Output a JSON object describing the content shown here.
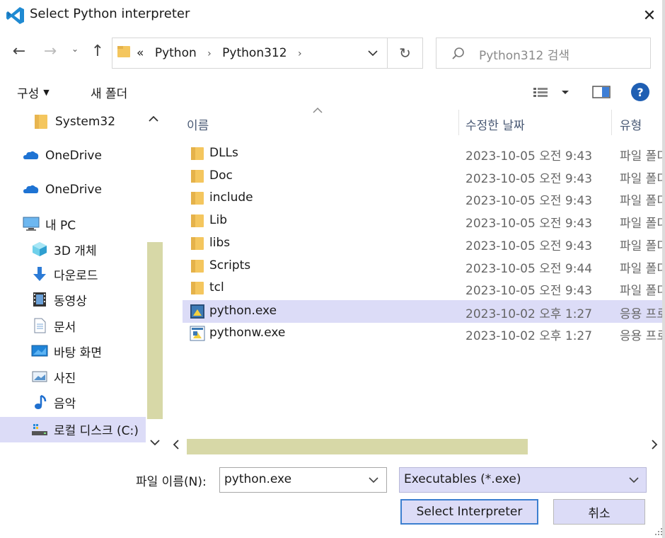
{
  "window": {
    "title": "Select Python interpreter",
    "close_label": "✕"
  },
  "nav": {
    "back": "←",
    "forward": "→",
    "recent": "⌄",
    "up": "↑",
    "breadcrumb_overflow": "«",
    "breadcrumbs": [
      "Python",
      "Python312"
    ],
    "crumb_separator": "›",
    "refresh": "↻"
  },
  "search": {
    "placeholder": "Python312 검색"
  },
  "toolbar": {
    "organize_label": "구성",
    "new_folder_label": "새 폴더",
    "help_label": "?"
  },
  "sidebar": {
    "items": [
      {
        "label": "System32",
        "icon": "folder-icon"
      },
      {
        "label": "OneDrive",
        "icon": "cloud-icon"
      },
      {
        "label": "OneDrive",
        "icon": "cloud-icon"
      },
      {
        "label": "내 PC",
        "icon": "pc-icon"
      },
      {
        "label": "3D 개체",
        "icon": "cube-icon"
      },
      {
        "label": "다운로드",
        "icon": "download-icon"
      },
      {
        "label": "동영상",
        "icon": "video-icon"
      },
      {
        "label": "문서",
        "icon": "document-icon"
      },
      {
        "label": "바탕 화면",
        "icon": "desktop-icon"
      },
      {
        "label": "사진",
        "icon": "picture-icon"
      },
      {
        "label": "음악",
        "icon": "music-icon"
      },
      {
        "label": "로컬 디스크 (C:)",
        "icon": "drive-icon"
      }
    ]
  },
  "list": {
    "columns": [
      "이름",
      "수정한 날짜",
      "유형"
    ],
    "rows": [
      {
        "name": "DLLs",
        "date": "2023-10-05 오전 9:43",
        "type": "파일 폴더",
        "icon": "folder-icon"
      },
      {
        "name": "Doc",
        "date": "2023-10-05 오전 9:43",
        "type": "파일 폴더",
        "icon": "folder-icon"
      },
      {
        "name": "include",
        "date": "2023-10-05 오전 9:43",
        "type": "파일 폴더",
        "icon": "folder-icon"
      },
      {
        "name": "Lib",
        "date": "2023-10-05 오전 9:43",
        "type": "파일 폴더",
        "icon": "folder-icon"
      },
      {
        "name": "libs",
        "date": "2023-10-05 오전 9:43",
        "type": "파일 폴더",
        "icon": "folder-icon"
      },
      {
        "name": "Scripts",
        "date": "2023-10-05 오전 9:44",
        "type": "파일 폴더",
        "icon": "folder-icon"
      },
      {
        "name": "tcl",
        "date": "2023-10-05 오전 9:43",
        "type": "파일 폴더",
        "icon": "folder-icon"
      },
      {
        "name": "python.exe",
        "date": "2023-10-02 오후 1:27",
        "type": "응용 프로그램",
        "icon": "python-exe-icon",
        "selected": true
      },
      {
        "name": "pythonw.exe",
        "date": "2023-10-02 오후 1:27",
        "type": "응용 프로그램",
        "icon": "pythonw-exe-icon"
      }
    ]
  },
  "footer": {
    "filename_label": "파일 이름(N):",
    "filename_value": "python.exe",
    "filetype_value": "Executables (*.exe)",
    "select_label": "Select Interpreter",
    "cancel_label": "취소"
  },
  "colors": {
    "selection": "#dcdcf7",
    "scrollbar_thumb": "#d7d8a7",
    "folder": "#f4c65e",
    "help_blue": "#1f5fb3"
  }
}
